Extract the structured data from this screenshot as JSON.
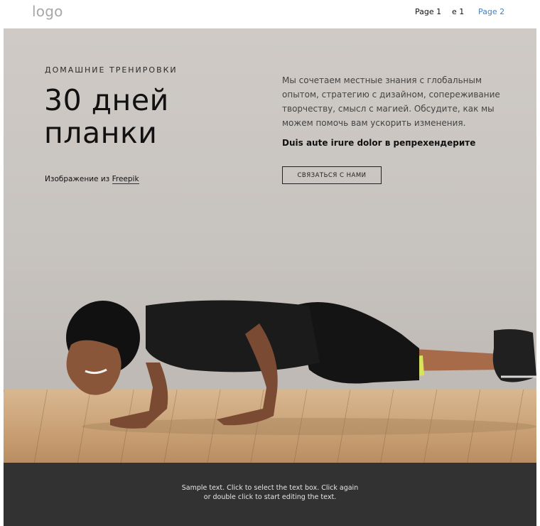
{
  "header": {
    "logo": "logo",
    "nav": [
      {
        "label": "Page 1",
        "active": false
      },
      {
        "label": "e 1",
        "active": false
      },
      {
        "label": "Page 2",
        "active": true
      }
    ]
  },
  "hero": {
    "kicker": "ДОМАШНИЕ ТРЕНИРОВКИ",
    "title_lines": [
      "30 дней",
      "планки"
    ],
    "credit_prefix": "Изображение из",
    "credit_link": "Freepik",
    "body": "Мы сочетаем местные знания с глобальным опытом, стратегию с дизайном, сопереживание творчеству, смысл с магией. Обсудите, как мы можем помочь вам ускорить изменения.",
    "emphasis": "Duis aute irure dolor в репрехендерите",
    "cta_label": "СВЯЗАТЬСЯ С НАМИ"
  },
  "footer": {
    "text": "Sample text. Click to select the text box. Click again or double click to start editing the text."
  },
  "colors": {
    "nav_active": "#4a7fb8",
    "hero_bg": "#c9c4c0",
    "footer_bg": "#323232",
    "floor": "#c89f73"
  }
}
